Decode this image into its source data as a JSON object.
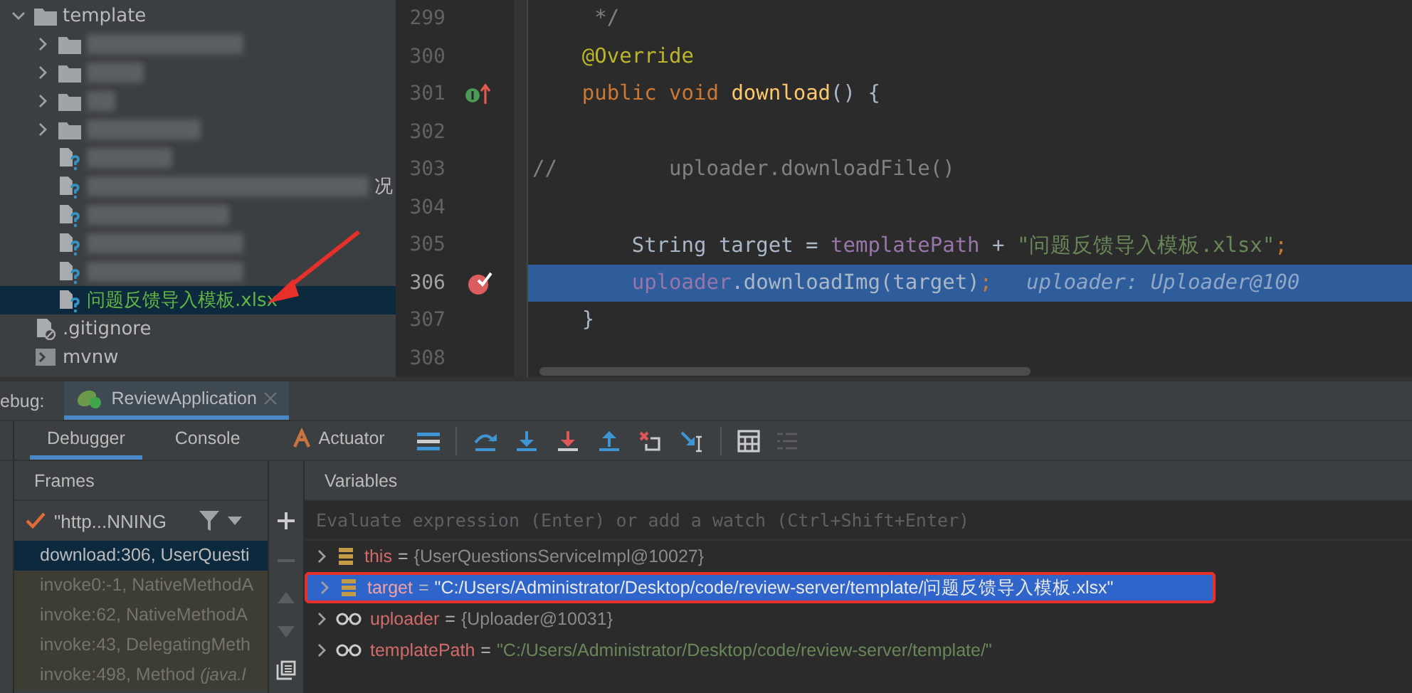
{
  "project": {
    "items": [
      {
        "kind": "folder",
        "name": "template",
        "expanded": true,
        "selected": false,
        "children": [
          {
            "kind": "blurred_folder",
            "expanded": false,
            "selected": false
          },
          {
            "kind": "blurred_folder",
            "expanded": false,
            "selected": false
          },
          {
            "kind": "blurred_folder",
            "expanded": false,
            "selected": false
          },
          {
            "kind": "blurred_folder",
            "expanded": false,
            "selected": false
          },
          {
            "kind": "blurred_file",
            "selected": false
          },
          {
            "kind": "blurred_file",
            "selected": false,
            "visible_tail": "况"
          },
          {
            "kind": "blurred_file",
            "selected": false
          },
          {
            "kind": "blurred_file",
            "selected": false
          },
          {
            "kind": "blurred_file",
            "selected": false
          },
          {
            "kind": "file",
            "name": "问题反馈导入模板.xlsx",
            "selected": true
          }
        ]
      },
      {
        "kind": "ignore_file",
        "name": ".gitignore",
        "selected": false
      },
      {
        "kind": "script_file",
        "name": "mvnw",
        "selected": false
      }
    ]
  },
  "editor": {
    "lines": [
      {
        "number": "299",
        "kind": "plain",
        "current": false,
        "tokens": [
          {
            "kind": "comment",
            "text": "     */"
          }
        ]
      },
      {
        "number": "300",
        "kind": "plain",
        "current": false,
        "tokens": [
          {
            "kind": "annotation",
            "text": "    @Override"
          }
        ]
      },
      {
        "number": "301",
        "kind": "override",
        "current": false,
        "tokens": [
          {
            "kind": "keyword",
            "text": "    public void "
          },
          {
            "kind": "method",
            "text": "download"
          },
          {
            "kind": "plain",
            "text": "() {"
          }
        ]
      },
      {
        "number": "302",
        "kind": "plain",
        "current": false
      },
      {
        "number": "303",
        "kind": "plain",
        "current": false,
        "tokens": [
          {
            "kind": "comment",
            "text": "//         uploader.downloadFile()"
          }
        ]
      },
      {
        "number": "304",
        "kind": "plain",
        "current": false
      },
      {
        "number": "305",
        "kind": "plain",
        "current": false,
        "tokens": [
          {
            "kind": "plain",
            "text": "        String target = "
          },
          {
            "kind": "field",
            "text": "templatePath"
          },
          {
            "kind": "plain",
            "text": " + "
          },
          {
            "kind": "string",
            "text": "\"问题反馈导入模板.xlsx\""
          },
          {
            "kind": "keyword",
            "text": ";"
          }
        ]
      },
      {
        "number": "306",
        "kind": "breakpoint",
        "current": true,
        "tokens": [
          {
            "kind": "field",
            "text": "        uploader"
          },
          {
            "kind": "plain",
            "text": ".downloadImg(target)"
          },
          {
            "kind": "keyword",
            "text": ";"
          }
        ],
        "inline_hint": "uploader: Uploader@100"
      },
      {
        "number": "307",
        "kind": "plain",
        "current": false,
        "tokens": [
          {
            "kind": "plain",
            "text": "    }"
          }
        ]
      },
      {
        "number": "308",
        "kind": "plain",
        "current": false
      }
    ]
  },
  "debug": {
    "label": "ebug:",
    "session_tab": {
      "label": "ReviewApplication",
      "selected": true
    },
    "tabs": [
      {
        "label": "Debugger",
        "selected": true
      },
      {
        "label": "Console",
        "selected": false
      },
      {
        "label": "Actuator",
        "selected": false
      }
    ],
    "frames": {
      "title": "Frames",
      "thread": "\"http...NNING",
      "items": [
        {
          "text": "download:306, UserQuesti",
          "selected": true,
          "library": false
        },
        {
          "text": "invoke0:-1, NativeMethodA",
          "selected": false,
          "library": true
        },
        {
          "text": "invoke:62, NativeMethodA",
          "selected": false,
          "library": true
        },
        {
          "text": "invoke:43, DelegatingMeth",
          "selected": false,
          "library": true
        },
        {
          "text": "invoke:498, Method ",
          "note": "(java.l",
          "selected": false,
          "library": true
        }
      ]
    },
    "variables": {
      "title": "Variables",
      "placeholder": "Evaluate expression (Enter) or add a watch (Ctrl+Shift+Enter)",
      "items": [
        {
          "kind": "field",
          "name": "this",
          "operator": "=",
          "value": {
            "kind": "object",
            "text": "{UserQuestionsServiceImpl@10027}"
          },
          "selected": false,
          "outlined": false
        },
        {
          "kind": "field",
          "name": "target",
          "operator": "=",
          "value": {
            "kind": "string",
            "text": "\"C:/Users/Administrator/Desktop/code/review-server/template/问题反馈导入模板.xlsx\""
          },
          "selected": true,
          "outlined": true
        },
        {
          "kind": "watch",
          "name": "uploader",
          "operator": "=",
          "value": {
            "kind": "object",
            "text": "{Uploader@10031}"
          },
          "selected": false,
          "outlined": false
        },
        {
          "kind": "watch",
          "name": "templatePath",
          "operator": "=",
          "value": {
            "kind": "string",
            "text": "\"C:/Users/Administrator/Desktop/code/review-server/template/\""
          },
          "selected": false,
          "outlined": false
        }
      ]
    }
  }
}
